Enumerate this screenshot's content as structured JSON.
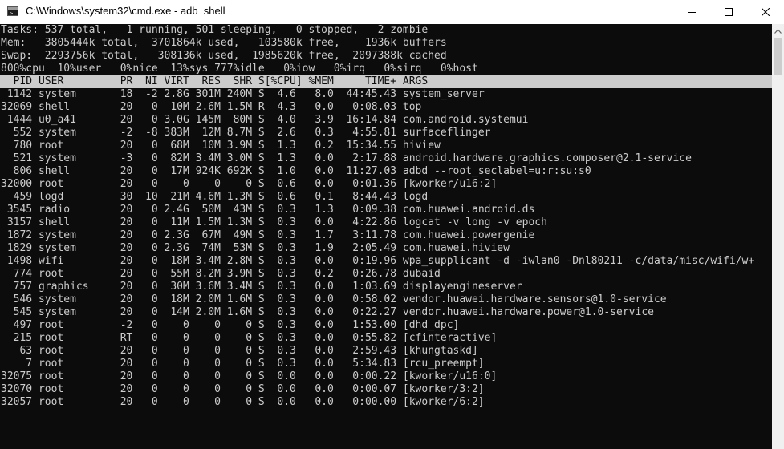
{
  "window": {
    "title": "C:\\Windows\\system32\\cmd.exe - adb  shell"
  },
  "summary": [
    "Tasks: 537 total,   1 running, 501 sleeping,   0 stopped,   2 zombie",
    "Mem:   3805444k total,  3701864k used,   103580k free,    1936k buffers",
    "Swap:  2293756k total,   308136k used,  1985620k free,  2097388k cached",
    "800%cpu  10%user   0%nice  13%sys 777%idle   0%iow   0%irq   0%sirq   0%host"
  ],
  "table_header": "  PID USER         PR  NI VIRT  RES  SHR S[%CPU] %MEM     TIME+ ARGS",
  "processes": [
    " 1142 system       18  -2 2.8G 301M 240M S  4.6   8.0  44:45.43 system_server",
    "32069 shell        20   0  10M 2.6M 1.5M R  4.3   0.0   0:08.03 top",
    " 1444 u0_a41       20   0 3.0G 145M  80M S  4.0   3.9  16:14.84 com.android.systemui",
    "  552 system       -2  -8 383M  12M 8.7M S  2.6   0.3   4:55.81 surfaceflinger",
    "  780 root         20   0  68M  10M 3.9M S  1.3   0.2  15:34.55 hiview",
    "  521 system       -3   0  82M 3.4M 3.0M S  1.3   0.0   2:17.88 android.hardware.graphics.composer@2.1-service",
    "  806 shell        20   0  17M 924K 692K S  1.0   0.0  11:27.03 adbd --root_seclabel=u:r:su:s0",
    "32000 root         20   0    0    0    0 S  0.6   0.0   0:01.36 [kworker/u16:2]",
    "  459 logd         30  10  21M 4.6M 1.3M S  0.6   0.1   8:44.43 logd",
    " 3545 radio        20   0 2.4G  50M  43M S  0.3   1.3   0:09.38 com.huawei.android.ds",
    " 3157 shell        20   0  11M 1.5M 1.3M S  0.3   0.0   4:22.86 logcat -v long -v epoch",
    " 1872 system       20   0 2.3G  67M  49M S  0.3   1.7   3:11.78 com.huawei.powergenie",
    " 1829 system       20   0 2.3G  74M  53M S  0.3   1.9   2:05.49 com.huawei.hiview",
    " 1498 wifi         20   0  18M 3.4M 2.8M S  0.3   0.0   0:19.96 wpa_supplicant -d -iwlan0 -Dnl80211 -c/data/misc/wifi/w+",
    "  774 root         20   0  55M 8.2M 3.9M S  0.3   0.2   0:26.78 dubaid",
    "  757 graphics     20   0  30M 3.6M 3.4M S  0.3   0.0   1:03.69 displayengineserver",
    "  546 system       20   0  18M 2.0M 1.6M S  0.3   0.0   0:58.02 vendor.huawei.hardware.sensors@1.0-service",
    "  545 system       20   0  14M 2.0M 1.6M S  0.3   0.0   0:22.27 vendor.huawei.hardware.power@1.0-service",
    "  497 root         -2   0    0    0    0 S  0.3   0.0   1:53.00 [dhd_dpc]",
    "  215 root         RT   0    0    0    0 S  0.3   0.0   0:55.82 [cfinteractive]",
    "   63 root         20   0    0    0    0 S  0.3   0.0   2:59.43 [khungtaskd]",
    "    7 root         20   0    0    0    0 S  0.3   0.0   5:34.83 [rcu_preempt]",
    "32075 root         20   0    0    0    0 S  0.0   0.0   0:00.22 [kworker/u16:0]",
    "32070 root         20   0    0    0    0 S  0.0   0.0   0:00.07 [kworker/3:2]",
    "32057 root         20   0    0    0    0 S  0.0   0.0   0:00.00 [kworker/6:2]"
  ],
  "colors": {
    "console_bg": "#0c0c0c",
    "console_fg": "#cccccc",
    "header_bg": "#cccccc",
    "titlebar_bg": "#ffffff"
  },
  "icons": {
    "app": "cmd-console-icon",
    "minimize": "minimize-icon",
    "maximize": "maximize-icon",
    "close": "close-icon",
    "scroll_up": "chevron-up-icon"
  }
}
